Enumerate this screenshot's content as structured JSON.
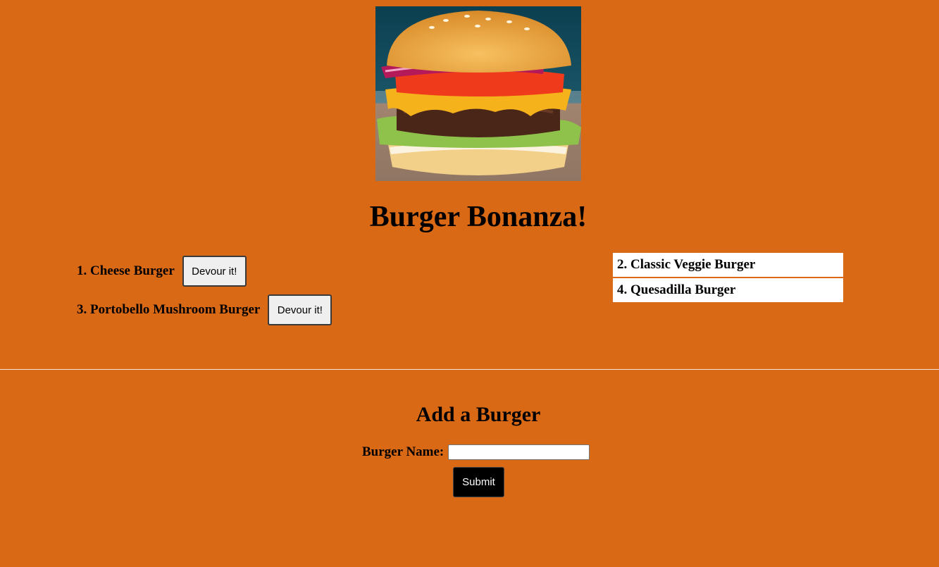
{
  "header": {
    "title": "Burger Bonanza!"
  },
  "hero_image": {
    "description_icon": "burger-photo"
  },
  "uneaten_burgers": [
    {
      "label": "1. Cheese Burger",
      "button_label": "Devour it!"
    },
    {
      "label": "3. Portobello Mushroom Burger",
      "button_label": "Devour it!"
    }
  ],
  "eaten_burgers": [
    {
      "label": "2. Classic Veggie Burger"
    },
    {
      "label": "4. Quesadilla Burger"
    }
  ],
  "add_form": {
    "title": "Add a Burger",
    "name_label": "Burger Name:",
    "name_value": "",
    "submit_label": "Submit"
  },
  "colors": {
    "background": "#d96914",
    "eaten_item_bg": "#ffffff",
    "submit_bg": "#000000"
  }
}
